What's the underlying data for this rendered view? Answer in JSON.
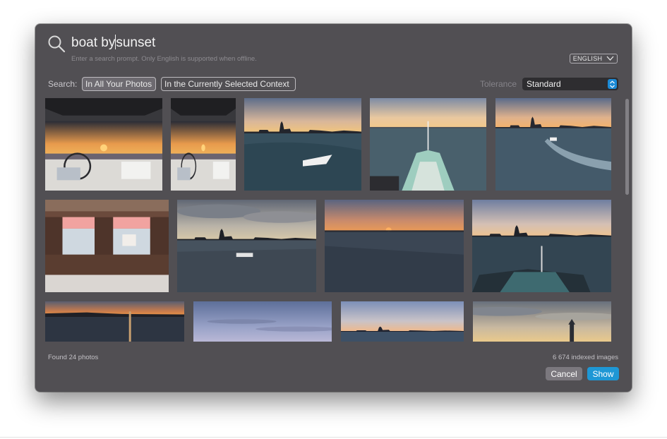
{
  "search": {
    "query_before_caret": "boat by",
    "query_after_caret": "sunset",
    "hint": "Enter a search prompt. Only English is supported when offline."
  },
  "language": {
    "label": "ENGLISH"
  },
  "scope": {
    "label": "Search:",
    "options": [
      "In All Your Photos",
      "In the Currently Selected Context"
    ],
    "selected": "In All Your Photos"
  },
  "tolerance": {
    "label": "Tolerance",
    "value": "Standard"
  },
  "results": {
    "found_text": "Found 24 photos",
    "indexed_text": "6 674 indexed images"
  },
  "buttons": {
    "cancel": "Cancel",
    "show": "Show"
  },
  "colors": {
    "dialog_bg": "#514f53",
    "accent": "#1e97d5",
    "stepper": "#1b8ad6"
  },
  "photos": [
    {
      "kind": "sunset-deck",
      "desc": ""
    },
    {
      "kind": "sunset-deck",
      "desc": ""
    },
    {
      "kind": "venice-boat",
      "desc": ""
    },
    {
      "kind": "bow",
      "desc": ""
    },
    {
      "kind": "venice-wake",
      "desc": ""
    },
    {
      "kind": "pier-window",
      "desc": ""
    },
    {
      "kind": "cloudy-skyline",
      "desc": ""
    },
    {
      "kind": "orange-sunset-water",
      "desc": ""
    },
    {
      "kind": "dusk-boat",
      "desc": ""
    },
    {
      "kind": "sunset-pier",
      "desc": ""
    },
    {
      "kind": "lavender-sky",
      "desc": ""
    },
    {
      "kind": "venice-skyline",
      "desc": ""
    },
    {
      "kind": "cloudy-sunset",
      "desc": ""
    }
  ]
}
